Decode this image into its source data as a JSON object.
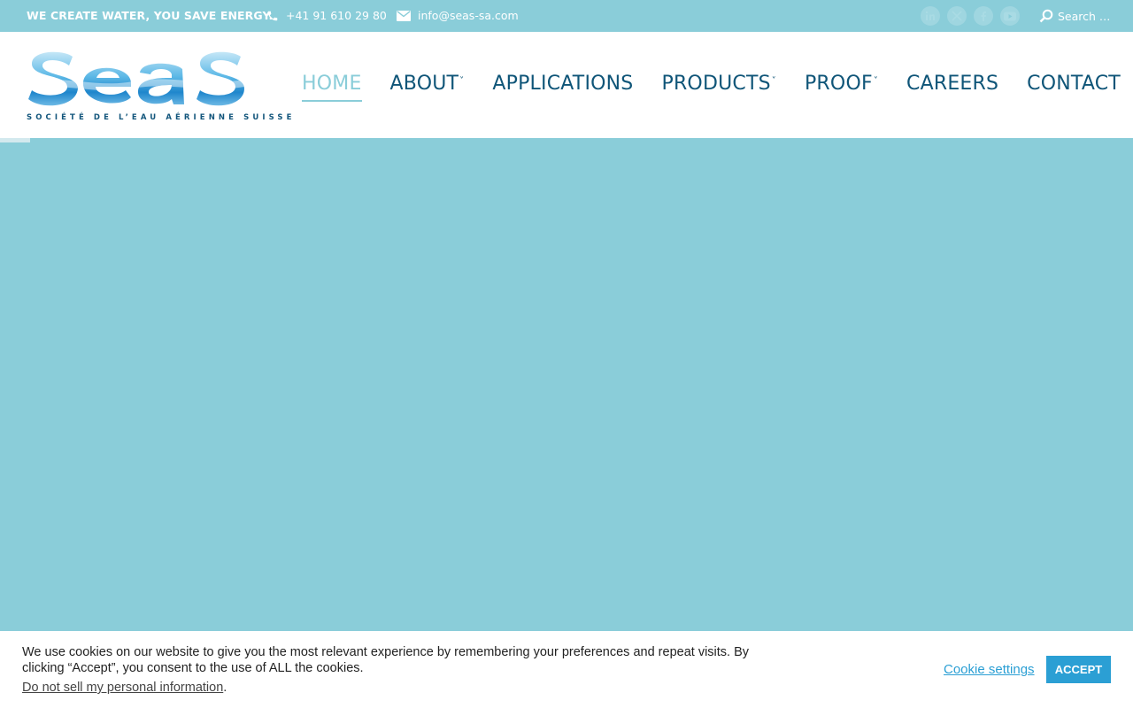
{
  "topbar": {
    "tagline": "WE CREATE WATER, YOU SAVE ENERGY.",
    "phone": "+41 91 610 29 80",
    "email": "info@seas-sa.com",
    "search_placeholder": "Search …",
    "socials": [
      "linkedin-icon",
      "x-icon",
      "facebook-icon",
      "youtube-icon"
    ]
  },
  "header": {
    "logo_subtitle": "SOCIÉTÉ DE L’EAU AÉRIENNE SUISSE"
  },
  "nav": {
    "items": [
      {
        "label": "HOME",
        "active": true,
        "dropdown": false
      },
      {
        "label": "ABOUT",
        "active": false,
        "dropdown": true
      },
      {
        "label": "APPLICATIONS",
        "active": false,
        "dropdown": false
      },
      {
        "label": "PRODUCTS",
        "active": false,
        "dropdown": true
      },
      {
        "label": "PROOF",
        "active": false,
        "dropdown": true
      },
      {
        "label": "CAREERS",
        "active": false,
        "dropdown": false
      },
      {
        "label": "CONTACT",
        "active": false,
        "dropdown": false
      }
    ]
  },
  "cookie": {
    "message": "We use cookies on our website to give you the most relevant experience by remembering your preferences and repeat visits. By clicking “Accept”, you consent to the use of ALL the cookies.",
    "do_not_sell": "Do not sell my personal information",
    "settings": "Cookie settings",
    "accept": "ACCEPT"
  },
  "colors": {
    "accent": "#8acdd9",
    "nav_text": "#0f5578",
    "button": "#2b9fd4"
  }
}
